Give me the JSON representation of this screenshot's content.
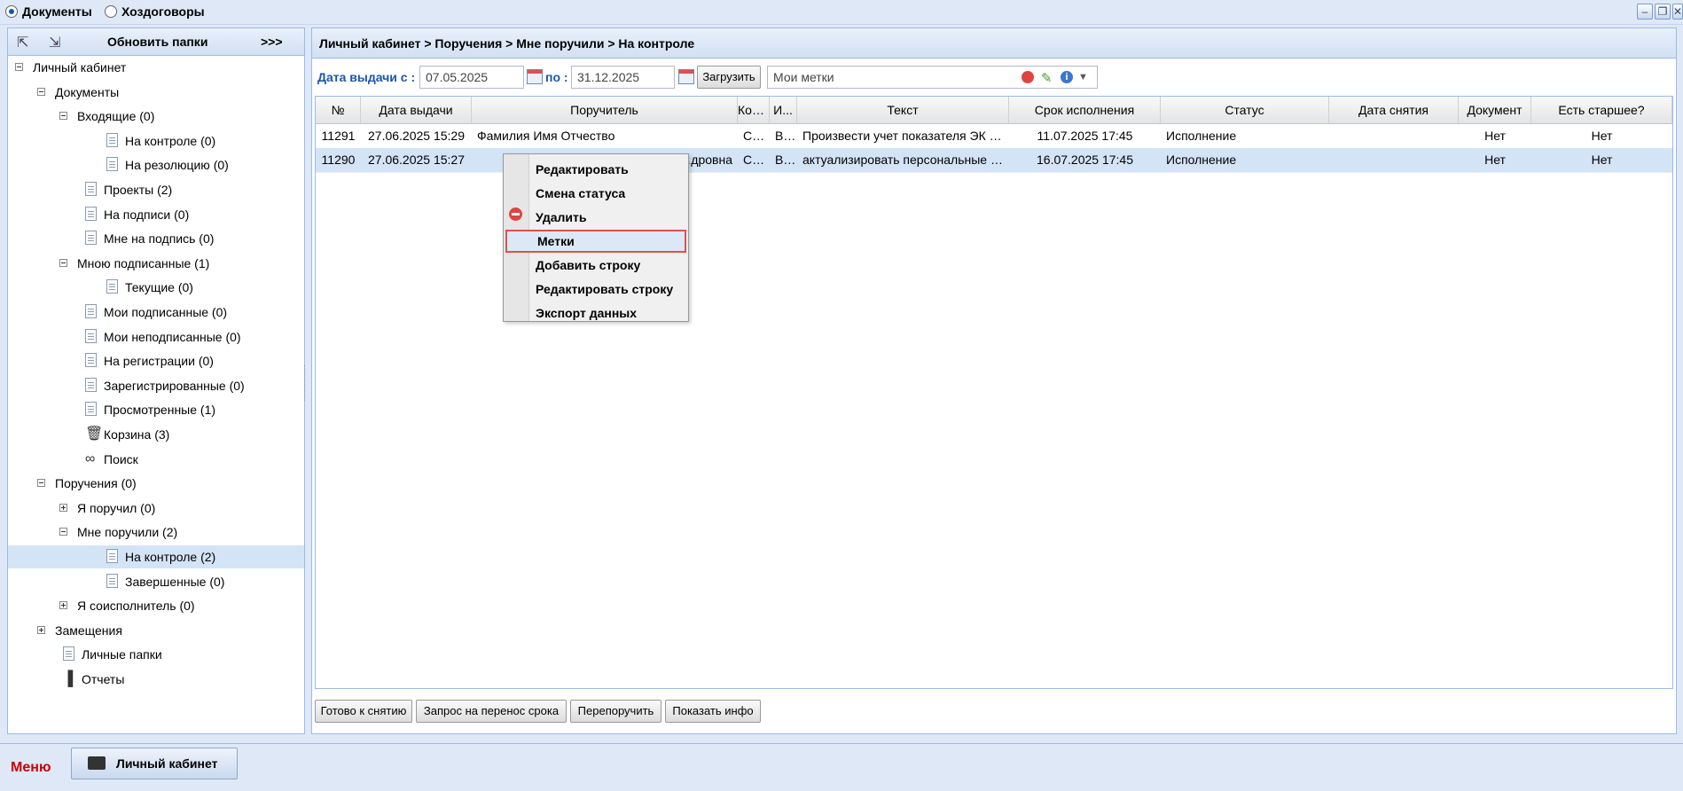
{
  "topbar": {
    "radio_documents": "Документы",
    "radio_contracts": "Хоздоговоры",
    "selected": "Документы"
  },
  "left": {
    "refresh_label": "Обновить папки",
    "more_label": ">>>",
    "tree": [
      {
        "label": "Личный кабинет",
        "level": 0,
        "expander": "minus",
        "icon": "none"
      },
      {
        "label": "Документы",
        "level": 1,
        "expander": "minus",
        "icon": "none"
      },
      {
        "label": "Входящие (0)",
        "level": 2,
        "expander": "minus",
        "icon": "none"
      },
      {
        "label": "На контроле (0)",
        "level": 3,
        "expander": "none",
        "icon": "document-icon"
      },
      {
        "label": "На резолюцию (0)",
        "level": 3,
        "expander": "none",
        "icon": "document-icon"
      },
      {
        "label": "Проекты (2)",
        "level": 2,
        "expander": "none",
        "icon": "document-icon"
      },
      {
        "label": "На подписи (0)",
        "level": 2,
        "expander": "none",
        "icon": "document-icon"
      },
      {
        "label": "Мне на подпись (0)",
        "level": 2,
        "expander": "none",
        "icon": "document-icon"
      },
      {
        "label": "Мною подписанные (1)",
        "level": 2,
        "expander": "minus",
        "icon": "none"
      },
      {
        "label": "Текущие (0)",
        "level": 3,
        "expander": "none",
        "icon": "document-icon"
      },
      {
        "label": "Мои подписанные (0)",
        "level": 2,
        "expander": "none",
        "icon": "document-icon"
      },
      {
        "label": "Мои неподписанные (0)",
        "level": 2,
        "expander": "none",
        "icon": "document-icon"
      },
      {
        "label": "На регистрации (0)",
        "level": 2,
        "expander": "none",
        "icon": "document-icon"
      },
      {
        "label": "Зарегистрированные (0)",
        "level": 2,
        "expander": "none",
        "icon": "document-icon"
      },
      {
        "label": "Просмотренные (1)",
        "level": 2,
        "expander": "none",
        "icon": "document-icon"
      },
      {
        "label": "Корзина (3)",
        "level": 2,
        "expander": "none",
        "icon": "trash-icon"
      },
      {
        "label": "Поиск",
        "level": 2,
        "expander": "none",
        "icon": "binoculars-icon"
      },
      {
        "label": "Поручения (0)",
        "level": 1,
        "expander": "minus",
        "icon": "none"
      },
      {
        "label": "Я поручил (0)",
        "level": 2,
        "expander": "plus",
        "icon": "none"
      },
      {
        "label": "Мне поручили (2)",
        "level": 2,
        "expander": "minus",
        "icon": "none"
      },
      {
        "label": "На контроле (2)",
        "level": 3,
        "expander": "none",
        "icon": "document-icon",
        "selected": true
      },
      {
        "label": "Завершенные (0)",
        "level": 3,
        "expander": "none",
        "icon": "document-icon"
      },
      {
        "label": "Я соисполнитель (0)",
        "level": 2,
        "expander": "plus",
        "icon": "none"
      },
      {
        "label": "Замещения",
        "level": 1,
        "expander": "plus",
        "icon": "none"
      },
      {
        "label": "Личные папки",
        "level": 1,
        "expander": "none",
        "icon": "document-icon"
      },
      {
        "label": "Отчеты",
        "level": 1,
        "expander": "none",
        "icon": "bar-chart-icon"
      }
    ]
  },
  "main": {
    "breadcrumb": "Личный кабинет > Поручения > Мне поручили > На контроле",
    "filter": {
      "date_from_label": "Дата выдачи с :",
      "date_from": "07.05.2025",
      "date_to_label": "по :",
      "date_to": "31.12.2025",
      "load_button": "Загрузить",
      "tags_placeholder": "Мои метки"
    },
    "columns": [
      "№",
      "Дата выдачи",
      "Поручитель",
      "Кон...",
      "И...",
      "Текст",
      "Срок исполнения",
      "Статус",
      "Дата снятия",
      "Документ",
      "Есть старшее?"
    ],
    "rows": [
      [
        "11291",
        "27.06.2025 15:29",
        "Фамилия Имя Отчество",
        "Си...",
        "В...",
        "Произвести учет показателя ЭК для ...",
        "11.07.2025 17:45",
        "Исполнение",
        "",
        "Нет",
        "Нет"
      ],
      [
        "11290",
        "27.06.2025 15:27",
        "…дровна",
        "Си...",
        "В...",
        "актуализировать персональные сайт...",
        "16.07.2025 17:45",
        "Исполнение",
        "",
        "Нет",
        "Нет"
      ]
    ],
    "bottom_buttons": [
      "Готово к снятию",
      "Запрос на перенос срока",
      "Перепоручить",
      "Показать инфо"
    ]
  },
  "context_menu": {
    "items": [
      "Редактировать",
      "Смена статуса",
      "Удалить",
      "Метки",
      "Добавить строку",
      "Редактировать строку",
      "Экспорт данных"
    ],
    "highlighted": "Метки"
  },
  "bottombar": {
    "menu_label": "Меню",
    "task_label": "Личный кабинет"
  },
  "colors": {
    "accent": "#1a57a8",
    "menu_red": "#cc0000",
    "selection": "#d4e4f7",
    "highlight_border": "#d9534f"
  }
}
